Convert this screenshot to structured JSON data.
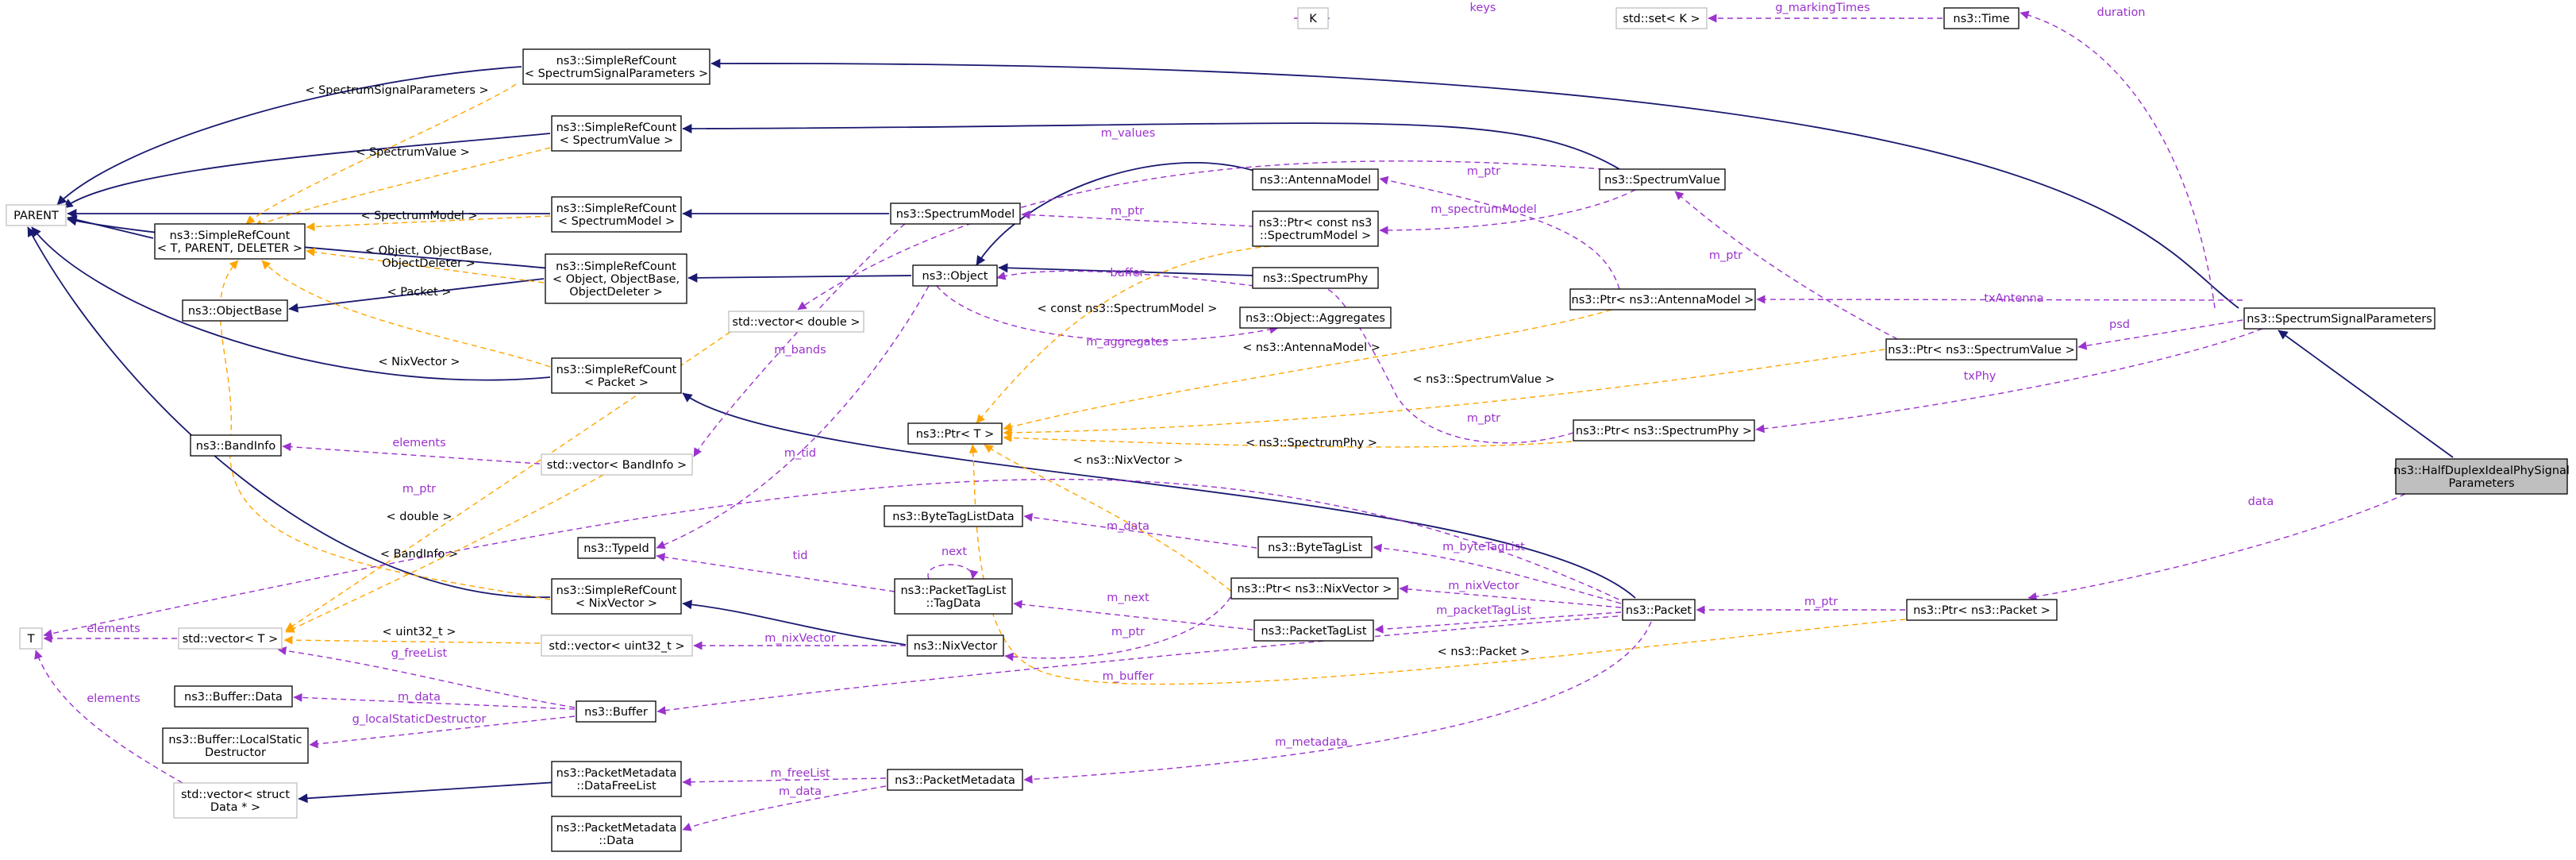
{
  "nodes": {
    "K": "K",
    "std_set_K": "std::set< K >",
    "Time": "ns3::Time",
    "SRC_SSP": [
      "ns3::SimpleRefCount",
      "< SpectrumSignalParameters >"
    ],
    "SRC_SV": [
      "ns3::SimpleRefCount",
      "< SpectrumValue >"
    ],
    "SRC_SM": [
      "ns3::SimpleRefCount",
      "< SpectrumModel >"
    ],
    "SRC_Obj": [
      "ns3::SimpleRefCount",
      "< Object, ObjectBase,",
      "ObjectDeleter >"
    ],
    "SRC_Pkt": [
      "ns3::SimpleRefCount",
      "< Packet >"
    ],
    "SRC_Nix": [
      "ns3::SimpleRefCount",
      "< NixVector >"
    ],
    "SRC_T": [
      "ns3::SimpleRefCount",
      "< T, PARENT, DELETER >"
    ],
    "PARENT": "PARENT",
    "ObjectBase": "ns3::ObjectBase",
    "BandInfo": "ns3::BandInfo",
    "T": "T",
    "vec_T": "std::vector< T >",
    "BufferData": "ns3::Buffer::Data",
    "BufferLSD": [
      "ns3::Buffer::LocalStatic",
      "Destructor"
    ],
    "vec_struct": [
      "std::vector< struct",
      "Data * >"
    ],
    "vec_double": "std::vector< double >",
    "vec_BandInfo": "std::vector< BandInfo >",
    "TypeId": "ns3::TypeId",
    "vec_uint32": "std::vector< uint32_t >",
    "Buffer": "ns3::Buffer",
    "PMDF": [
      "ns3::PacketMetadata",
      "::DataFreeList"
    ],
    "PMD": [
      "ns3::PacketMetadata",
      "::Data"
    ],
    "SpectrumModel": "ns3::SpectrumModel",
    "Object": "ns3::Object",
    "Ptr_T": "ns3::Ptr< T >",
    "ByteTagListData": "ns3::ByteTagListData",
    "PTLTagData": [
      "ns3::PacketTagList",
      "::TagData"
    ],
    "NixVector": "ns3::NixVector",
    "PacketMetadata": "ns3::PacketMetadata",
    "AntennaModel": "ns3::AntennaModel",
    "Ptr_constSM": [
      "ns3::Ptr< const ns3",
      "::SpectrumModel >"
    ],
    "SpectrumPhy": "ns3::SpectrumPhy",
    "ObjAggregates": "ns3::Object::Aggregates",
    "ByteTagList": "ns3::ByteTagList",
    "Ptr_Nix": "ns3::Ptr< ns3::NixVector >",
    "PacketTagList": "ns3::PacketTagList",
    "SpectrumValue": "ns3::SpectrumValue",
    "Ptr_Antenna": "ns3::Ptr< ns3::AntennaModel >",
    "Ptr_SV": "ns3::Ptr< ns3::SpectrumValue >",
    "Ptr_SPhy": "ns3::Ptr< ns3::SpectrumPhy >",
    "Packet": "ns3::Packet",
    "Ptr_Packet": "ns3::Ptr< ns3::Packet >",
    "SSP": "ns3::SpectrumSignalParameters",
    "HDIPSP": [
      "ns3::HalfDuplexIdealPhySignal",
      "Parameters"
    ]
  },
  "edge_labels": {
    "keys": "keys",
    "g_markingTimes": "g_markingTimes",
    "duration": "duration",
    "tpl_SSP": "< SpectrumSignalParameters >",
    "tpl_SV": "< SpectrumValue >",
    "tpl_SM": "< SpectrumModel >",
    "tpl_Obj": [
      "< Object, ObjectBase,",
      "ObjectDeleter >"
    ],
    "tpl_Pkt": "< Packet >",
    "tpl_Nix": "< NixVector >",
    "m_values": "m_values",
    "m_ptr_antenna": "m_ptr",
    "m_ptr_sm": "m_ptr",
    "m_spectrumModel": "m_spectrumModel",
    "buffer": "buffer",
    "m_ptr_sv": "m_ptr",
    "txAntenna": "txAntenna",
    "psd": "psd",
    "txPhy": "txPhy",
    "m_aggregates": "m_aggregates",
    "tpl_constSM": "< const ns3::SpectrumModel >",
    "tpl_AntennaModel": "< ns3::AntennaModel >",
    "tpl_SpectrumValue": "< ns3::SpectrumValue >",
    "tpl_SpectrumPhy": "< ns3::SpectrumPhy >",
    "m_ptr_sphy": "m_ptr",
    "m_bands": "m_bands",
    "elements_bandinfo": "elements",
    "m_tid": "m_tid",
    "m_ptr_T": "m_ptr",
    "tpl_double": "< double >",
    "tpl_BandInfo": "< BandInfo >",
    "elements_T": "elements",
    "tpl_uint32": "< uint32_t >",
    "g_freeList": "g_freeList",
    "m_data_buffer": "m_data",
    "g_localStaticDestructor": "g_localStaticDestructor",
    "elements_struct": "elements",
    "m_freeList": "m_freeList",
    "m_data_pmd": "m_data",
    "m_nixVector_nv": "m_nixVector",
    "m_ptr_nix": "m_ptr",
    "m_buffer": "m_buffer",
    "m_metadata": "m_metadata",
    "m_data_btl": "m_data",
    "next": "next",
    "tid": "tid",
    "m_next": "m_next",
    "tpl_NixVector": "< ns3::NixVector >",
    "m_byteTagList": "m_byteTagList",
    "m_nixVector": "m_nixVector",
    "m_packetTagList": "m_packetTagList",
    "tpl_Packet": "< ns3::Packet >",
    "m_ptr_pkt": "m_ptr",
    "data": "data"
  },
  "colors": {
    "inheritance": "#191970",
    "member": "#9a32cd",
    "template": "#ffa500",
    "focus_fill": "#bfbfbf",
    "ghost_border": "#bfbfbf"
  }
}
